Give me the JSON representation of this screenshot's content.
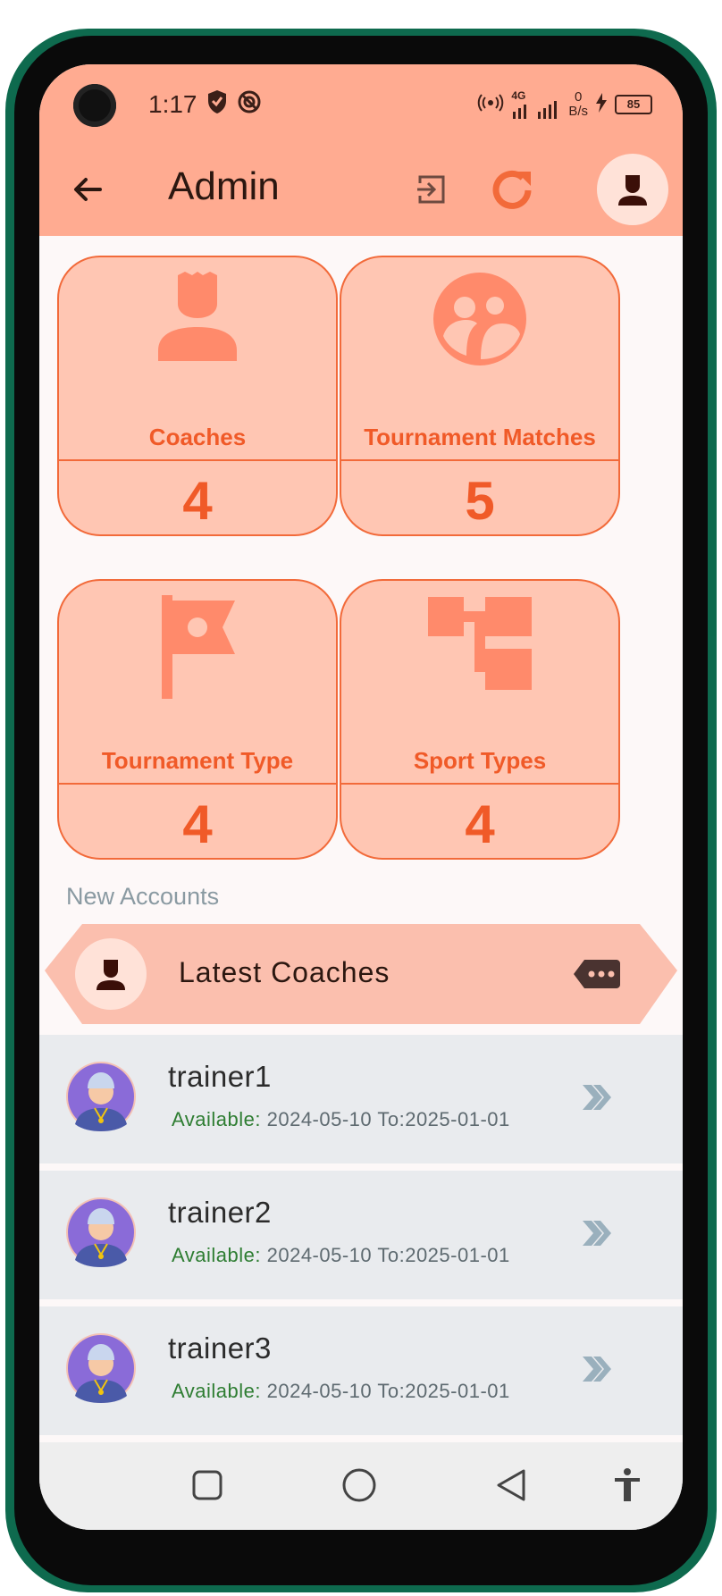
{
  "status_bar": {
    "time": "1:17",
    "net_speed_value": "0",
    "net_speed_unit": "B/s",
    "network": "4G",
    "battery": "85"
  },
  "app_bar": {
    "title": "Admin"
  },
  "cards": [
    {
      "label": "Coaches",
      "count": "4",
      "icon": "person-icon"
    },
    {
      "label": "Tournament Matches",
      "count": "5",
      "icon": "group-icon"
    },
    {
      "label": "Tournament Type",
      "count": "4",
      "icon": "flag-icon"
    },
    {
      "label": "Sport Types",
      "count": "4",
      "icon": "hierarchy-icon"
    }
  ],
  "section": {
    "label": "New Accounts"
  },
  "banner": {
    "title": "Latest Coaches"
  },
  "coaches": [
    {
      "name": "trainer1",
      "available_label": "Available:",
      "range": " 2024-05-10 To:2025-01-01"
    },
    {
      "name": "trainer2",
      "available_label": "Available:",
      "range": " 2024-05-10 To:2025-01-01"
    },
    {
      "name": "trainer3",
      "available_label": "Available:",
      "range": " 2024-05-10 To:2025-01-01"
    }
  ],
  "colors": {
    "app_bar": "#ffab91",
    "accent": "#f05a28",
    "card_bg": "#ffc6b3",
    "available_green": "#2e7d32"
  }
}
